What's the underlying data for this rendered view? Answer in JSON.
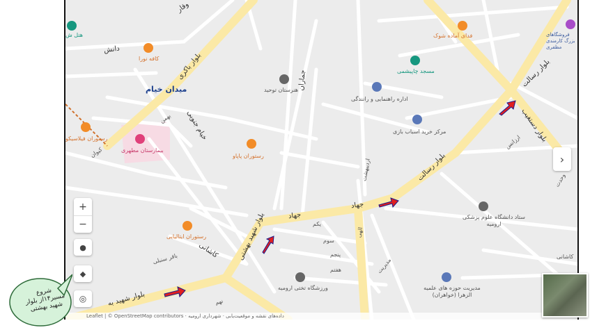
{
  "map": {
    "labels": {
      "vaqar": "وقار",
      "daneshgah": "دانش",
      "bolvar_bakeri": "بلوار باکری",
      "meydan_khayyam": "میدان خیام",
      "khayyam_jonubi": "خیام جنوبی",
      "jahad": "جهاد",
      "jahad2": "جهاد",
      "jamaran": "جماران",
      "bolvar_resalat": "بلوار رسالت",
      "bolvar_resalat2": "بلوار رسالت",
      "bolvar_dastgheyb": "بلوار دستغیب",
      "bolvar_shahid_beheshti": "بلوار شهید بهشتی",
      "bolvar_shahid_bah": "بلوار شهید به",
      "kashani": "کاشانی",
      "bagher_sonbli": "باقر سنبلی",
      "yekom": "یکم",
      "sevom": "سوم",
      "panjom": "پنجم",
      "haftom": "هفتم",
      "modiriat": "مدیریت",
      "bahman": "بهمن",
      "kivan": "کیوان",
      "azadi": "ارزانس",
      "ordibehesht": "اردیبهشت",
      "vahdat": "وحدت",
      "hashtom": "نهم",
      "elahi": "الهی",
      "misc1": "کاشانی"
    },
    "pois": {
      "hotel": "هتل ش",
      "kafe": "کافه نورا",
      "fastfood": "فدای آماده شوک",
      "masjed": "مسجد چاپیشمی",
      "honarestan": "هنرستان توحید",
      "edare": "اداره راهنمایی و رانندگی",
      "markaz": "مرکز خرید اسباب بازی",
      "shop_right": "فروشگاهای بزرگ کارمندی مظفری",
      "rest_left": "رستوران فیلاسیکو",
      "bimarestan": "بیمارستان مطهری",
      "rest_papa": "رستوران پاپاو",
      "setad": "ستاد دانشگاه علوم پزشکی ارومیه",
      "rest_italy": "رستوران ایتالیایی",
      "varzeshgah": "ورزشگاه تختی ارومیه",
      "howze": "مدیریت حوزه های علمیه الزهرا (خواهران)"
    },
    "attribution": "Leaflet | © OpenStreetMap contributors · داده‌های نقشه و موقعیت‌یابی · شهرداری ارومیه",
    "zoom_in": "+",
    "zoom_out": "−",
    "expand_label": "›"
  },
  "callout": {
    "line1": "شروع",
    "line2": "مسیر۱۴از بلوار",
    "line3": "شهید بهشتی"
  },
  "colors": {
    "road_major": "#fbe9a6",
    "road_minor": "#ffffff",
    "background": "#ececec",
    "arrow": "#e02020",
    "hospital": "#f7dbe4"
  }
}
